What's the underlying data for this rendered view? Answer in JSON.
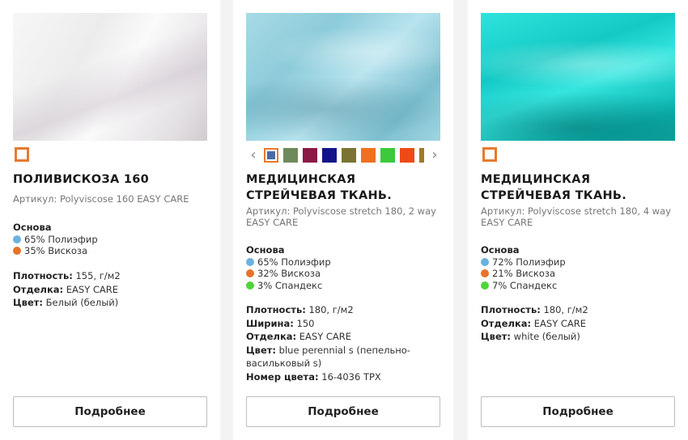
{
  "colors": {
    "polyester": "#6ab2e0",
    "viscose": "#e8722a",
    "spandex": "#4fd43a",
    "accent": "#e77a2e"
  },
  "cards": [
    {
      "title": "ПОЛИВИСКОЗА 160",
      "article": "Артикул: Polyviscose 160 EASY CARE",
      "base_label": "Основа",
      "composition": [
        "65% Полиэфир",
        "35% Вискоза"
      ],
      "props": [
        {
          "label": "Плотность:",
          "value": "155, г/м2"
        },
        {
          "label": "Отделка:",
          "value": "EASY CARE"
        },
        {
          "label": "Цвет:",
          "value": "Белый (белый)"
        }
      ],
      "button": "Подробнее"
    },
    {
      "title": "МЕДИЦИНСКАЯ СТРЕЙЧЕВАЯ ТКАНЬ.",
      "article": "Артикул: Polyviscose stretch 180, 2 way EASY CARE",
      "base_label": "Основа",
      "composition": [
        "65% Полиэфир",
        "32% Вискоза",
        "3% Спандекс"
      ],
      "props": [
        {
          "label": "Плотность:",
          "value": "180, г/м2"
        },
        {
          "label": "Ширина:",
          "value": "150"
        },
        {
          "label": "Отделка:",
          "value": "EASY CARE"
        },
        {
          "label": "Цвет:",
          "value": "blue perennial s (пепельно-васильковый s)"
        },
        {
          "label": "Номер цвета:",
          "value": "16-4036 TPX"
        }
      ],
      "swatch_colors": [
        "#4a6aa3",
        "#6e8a5a",
        "#8a1a45",
        "#14148a",
        "#7a7432",
        "#f07020",
        "#3cc93c",
        "#ef4a16",
        "#9c7a28"
      ],
      "button": "Подробнее"
    },
    {
      "title": "МЕДИЦИНСКАЯ СТРЕЙЧЕВАЯ ТКАНЬ.",
      "article": "Артикул: Polyviscose stretch 180, 4 way EASY CARE",
      "base_label": "Основа",
      "composition": [
        "72% Полиэфир",
        "21% Вискоза",
        "7% Спандекс"
      ],
      "props": [
        {
          "label": "Плотность:",
          "value": "180, г/м2"
        },
        {
          "label": "Отделка:",
          "value": "EASY CARE"
        },
        {
          "label": "Цвет:",
          "value": "white (белый)"
        }
      ],
      "button": "Подробнее"
    }
  ]
}
